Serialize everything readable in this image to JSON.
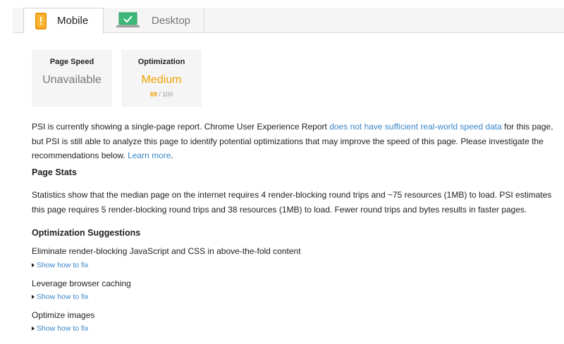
{
  "tabs": [
    {
      "label": "Mobile",
      "icon": "phone-warning-icon",
      "selected": true
    },
    {
      "label": "Desktop",
      "icon": "laptop-check-icon",
      "selected": false
    }
  ],
  "scores": {
    "page_speed": {
      "title": "Page Speed",
      "value": "Unavailable"
    },
    "optimization": {
      "title": "Optimization",
      "value": "Medium",
      "score": "69",
      "max": "100"
    }
  },
  "intro": {
    "text_before": "PSI is currently showing a single-page report. Chrome User Experience Report ",
    "link1": "does not have sufficient real-world speed data",
    "text_middle": " for this page, but PSI is still able to analyze this page to identify potential optimizations that may improve the speed of this page. Please investigate the recommendations below. ",
    "link2": "Learn more",
    "text_after": "."
  },
  "page_stats": {
    "heading": "Page Stats",
    "text": "Statistics show that the median page on the internet requires 4 render-blocking round trips and ~75 resources (1MB) to load. PSI estimates this page requires 5 render-blocking round trips and 38 resources (1MB) to load. Fewer round trips and bytes results in faster pages."
  },
  "optimization_suggestions": {
    "heading": "Optimization Suggestions",
    "items": [
      {
        "title": "Eliminate render-blocking JavaScript and CSS in above-the-fold content",
        "fix_label": "Show how to fix"
      },
      {
        "title": "Leverage browser caching",
        "fix_label": "Show how to fix"
      },
      {
        "title": "Optimize images",
        "fix_label": "Show how to fix"
      }
    ]
  },
  "colors": {
    "accent_orange": "#f0a100",
    "link_blue": "#3a86c8",
    "check_green": "#3cb878"
  }
}
